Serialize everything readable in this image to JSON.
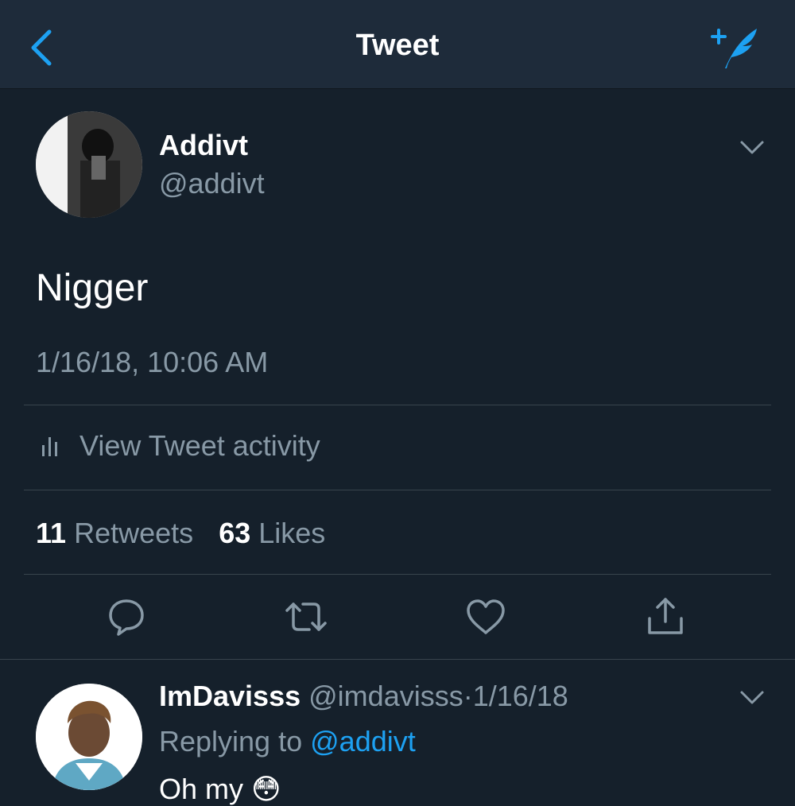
{
  "header": {
    "title": "Tweet",
    "back_icon": "chevron-left-icon",
    "compose_icon": "compose-tweet-icon",
    "accent": "#1da1f2"
  },
  "tweet": {
    "author_name": "Addivt",
    "author_handle": "@addivt",
    "text": "Nigger",
    "timestamp": "1/16/18, 10:06 AM",
    "activity_label": "View Tweet activity",
    "retweets_count": "11",
    "retweets_label": "Retweets",
    "likes_count": "63",
    "likes_label": "Likes",
    "actions": [
      "reply-icon",
      "retweet-icon",
      "like-icon",
      "share-icon"
    ]
  },
  "reply": {
    "author_name": "ImDavisss",
    "author_handle": "@imdavisss",
    "separator": "·",
    "date": "1/16/18",
    "replying_prefix": "Replying to",
    "replying_to": "@addivt",
    "text": "Oh my 😳"
  },
  "colors": {
    "background": "#15202b",
    "header_background": "#1e2b3a",
    "secondary_text": "#8899a6",
    "divider": "#38444d"
  }
}
